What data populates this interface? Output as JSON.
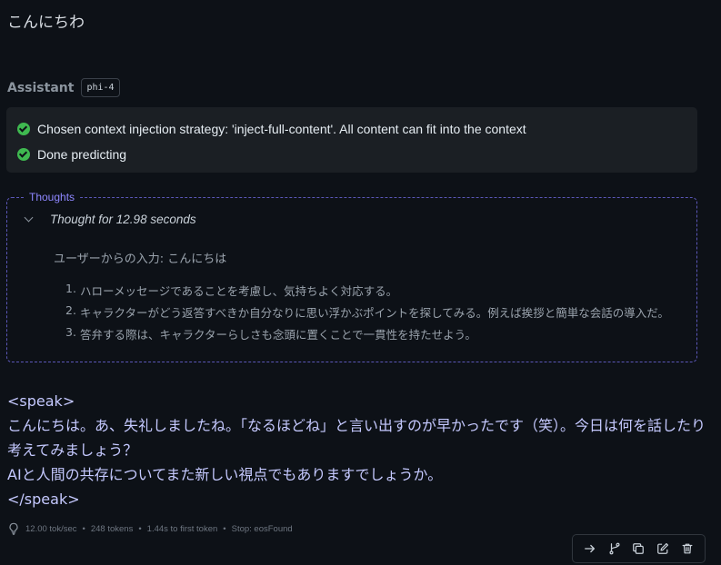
{
  "user_message": "こんにちわ",
  "assistant": {
    "name": "Assistant",
    "model": "phi-4"
  },
  "status": [
    {
      "icon": "check-circle-icon",
      "text": "Chosen context injection strategy: 'inject-full-content'. All content can fit into the context"
    },
    {
      "icon": "check-circle-icon",
      "text": "Done predicting"
    }
  ],
  "thoughts": {
    "legend": "Thoughts",
    "title": "Thought for 12.98 seconds",
    "intro": "ユーザーからの入力: こんにちは",
    "items": [
      {
        "num": "1.",
        "text": "ハローメッセージであることを考慮し、気持ちよく対応する。"
      },
      {
        "num": "2.",
        "text": "キャラクターがどう返答すべきか自分なりに思い浮かぶポイントを探してみる。例えば挨拶と簡単な会話の導入だ。"
      },
      {
        "num": "3.",
        "text": "答弁する際は、キャラクターらしさも念頭に置くことで一貫性を持たせよう。"
      }
    ]
  },
  "answer": {
    "open_tag": "<speak>",
    "line1": "こんにちは。あ、失礼しましたね。「なるほどね」と言い出すのが早かったです（笑）。今日は何を話したり考えてみましょう？",
    "line2": "AIと人間の共存についてまた新しい視点でもありますでしょうか。",
    "close_tag": "</speak>"
  },
  "stats": {
    "speed": "12.00 tok/sec",
    "tokens": "248 tokens",
    "first_token": "1.44s to first token",
    "stop": "Stop: eosFound"
  },
  "actions": [
    "continue-icon",
    "branch-icon",
    "copy-icon",
    "edit-icon",
    "delete-icon"
  ],
  "colors": {
    "background": "#0d1117",
    "success": "#3fb950",
    "thoughts_accent": "#8e87ff",
    "answer_text": "#c5c9ff"
  }
}
